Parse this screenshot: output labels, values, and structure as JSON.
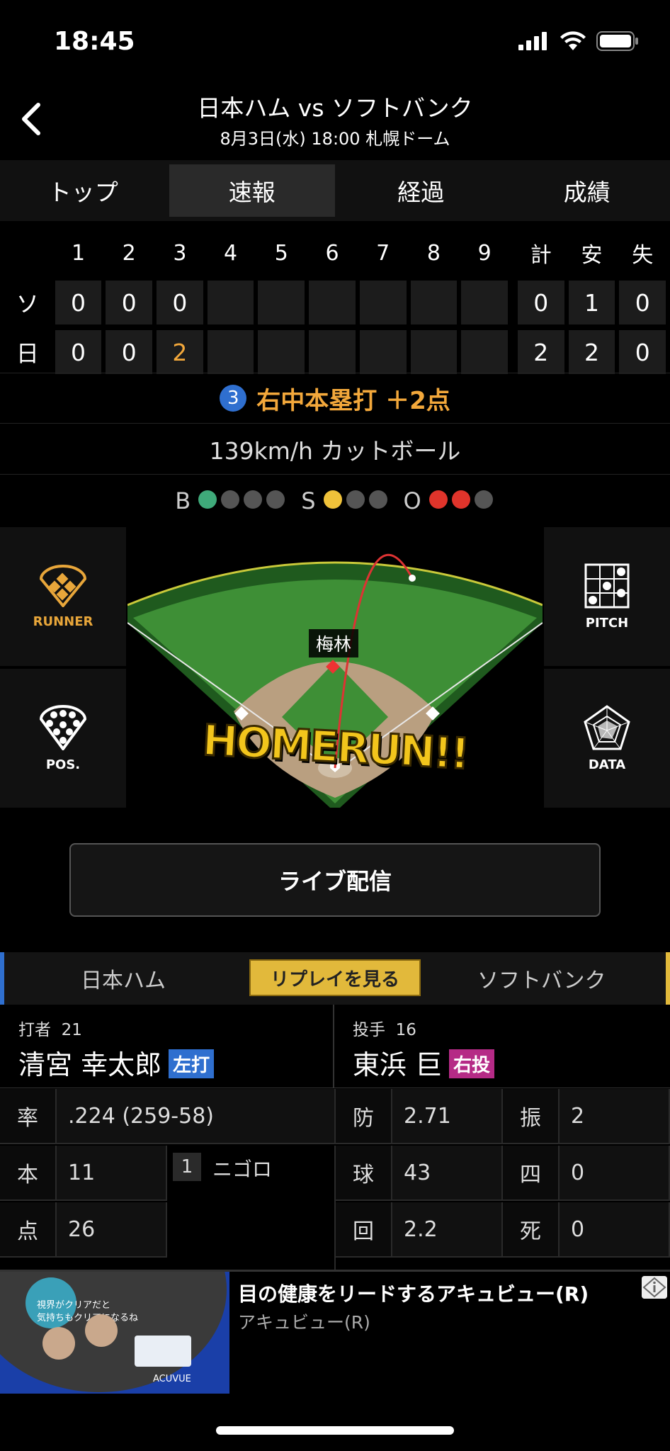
{
  "status": {
    "time": "18:45"
  },
  "header": {
    "title": "日本ハム vs ソフトバンク",
    "subtitle": "8月3日(水) 18:00 札幌ドーム"
  },
  "tabs": [
    {
      "label": "トップ",
      "active": false
    },
    {
      "label": "速報",
      "active": true
    },
    {
      "label": "経過",
      "active": false
    },
    {
      "label": "成績",
      "active": false
    }
  ],
  "scoreboard": {
    "headers": [
      "1",
      "2",
      "3",
      "4",
      "5",
      "6",
      "7",
      "8",
      "9",
      "計",
      "安",
      "失"
    ],
    "rows": [
      {
        "team": "ソ",
        "innings": [
          "0",
          "0",
          "0",
          "",
          "",
          "",
          "",
          "",
          ""
        ],
        "runs": "0",
        "hits": "1",
        "errors": "0"
      },
      {
        "team": "日",
        "innings": [
          "0",
          "0",
          "2",
          "",
          "",
          "",
          "",
          "",
          ""
        ],
        "runs": "2",
        "hits": "2",
        "errors": "0"
      }
    ]
  },
  "play": {
    "inning": "3",
    "text": "右中本塁打 ＋2点"
  },
  "pitch": {
    "text": "139km/h カットボール"
  },
  "count": {
    "b_label": "B",
    "s_label": "S",
    "o_label": "O",
    "balls": 1,
    "strikes": 1,
    "outs": 2,
    "colors": {
      "ball": "#3faa7a",
      "strike": "#f0c23a",
      "out": "#e0342b",
      "off": "#555555"
    }
  },
  "field": {
    "pitcher_name": "梅林",
    "banner": "HOMERUN!!",
    "buttons": {
      "runner": "RUNNER",
      "pitch": "PITCH",
      "pos": "POS.",
      "data": "DATA"
    }
  },
  "live_button": "ライブ配信",
  "teambar": {
    "home": "日本ハム",
    "replay": "リプレイを見る",
    "away": "ソフトバンク"
  },
  "batter": {
    "role": "打者",
    "number": "21",
    "name": "清宮 幸太郎",
    "tag": "左打"
  },
  "pitcher": {
    "role": "投手",
    "number": "16",
    "name": "東浜 巨",
    "tag": "右投"
  },
  "batter_stats": {
    "avg_label": "率",
    "avg": ".224 (259-58)",
    "hr_label": "本",
    "hr": "11",
    "rbi_label": "点",
    "rbi": "26",
    "at_bat_no": "1",
    "at_bat_result": "ニゴロ"
  },
  "pitcher_stats": {
    "era_label": "防",
    "era": "2.71",
    "so_label": "振",
    "so": "2",
    "pitches_label": "球",
    "pitches": "43",
    "bb_label": "四",
    "bb": "0",
    "ip_label": "回",
    "ip": "2.2",
    "hbp_label": "死",
    "hbp": "0"
  },
  "ad": {
    "title": "目の健康をリードするアキュビュー(R)",
    "sponsor": "アキュビュー(R)",
    "image_text_1": "視界がクリアだと",
    "image_text_2": "気持ちもクリアになるね",
    "brand": "ACUVUE"
  }
}
